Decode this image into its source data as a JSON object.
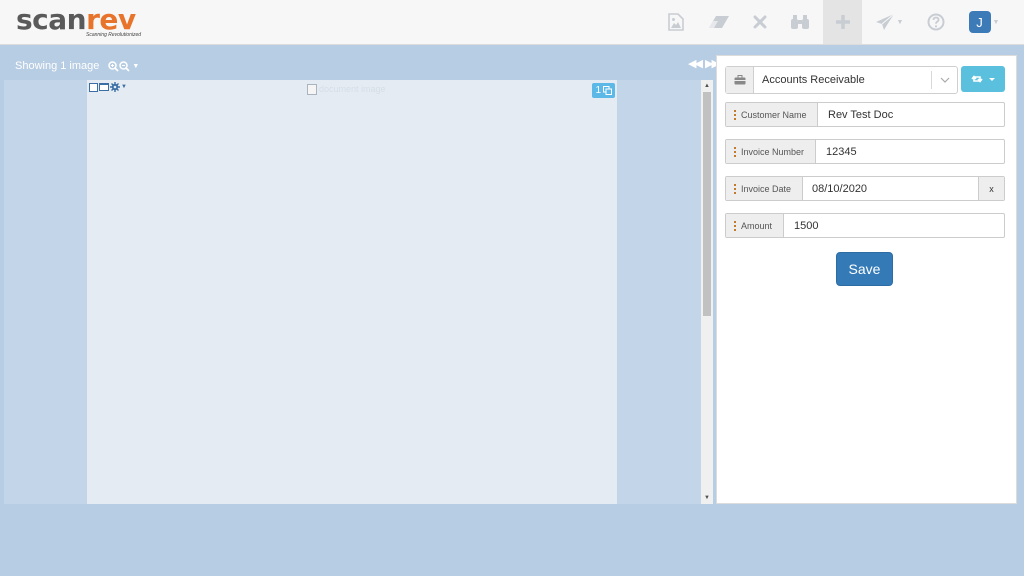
{
  "app": {
    "logo_scan": "scan",
    "logo_rev": "rev",
    "logo_tagline": "Scanning Revolutionized",
    "brand_color": "#e8732a"
  },
  "toolbar": {
    "items": [
      {
        "name": "insert-image",
        "icon": "image-icon"
      },
      {
        "name": "erase",
        "icon": "eraser-icon"
      },
      {
        "name": "delete",
        "icon": "close-icon"
      },
      {
        "name": "find",
        "icon": "binoculars-icon"
      },
      {
        "name": "add",
        "icon": "plus-icon",
        "active": true
      },
      {
        "name": "send",
        "icon": "paper-plane-icon"
      },
      {
        "name": "help",
        "icon": "question-circle-icon"
      }
    ],
    "user_initial": "J"
  },
  "viewer": {
    "showing_text": "Showing 1 image",
    "page_badge": "1",
    "broken_image_alt": "document image"
  },
  "panel": {
    "document_type": "Accounts Receivable",
    "save_label": "Save",
    "clear_label": "x",
    "fields": [
      {
        "label": "Customer Name",
        "value": "Rev Test Doc"
      },
      {
        "label": "Invoice Number",
        "value": "12345"
      },
      {
        "label": "Invoice Date",
        "value": "08/10/2020"
      },
      {
        "label": "Amount",
        "value": "1500"
      }
    ]
  },
  "colors": {
    "background": "#b7cde3",
    "primary_button": "#337ab7",
    "info_button": "#5bc0de",
    "avatar": "#3d7ab8"
  }
}
